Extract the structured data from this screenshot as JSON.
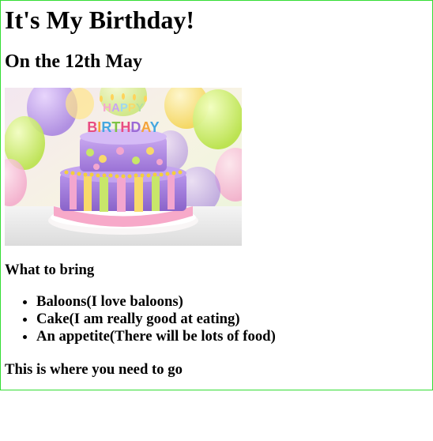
{
  "page": {
    "title": "It's My Birthday!",
    "subtitle": "On the 12th May"
  },
  "image": {
    "cake_topper_text": "HAPPY BIRTHDAY"
  },
  "bring": {
    "heading": "What to bring",
    "items": [
      "Baloons(I love baloons)",
      "Cake(I am really good at eating)",
      "An appetite(There will be lots of food)"
    ]
  },
  "footer": {
    "location_heading": "This is where you need to go"
  },
  "colors": {
    "frame_border": "#33dd33"
  }
}
